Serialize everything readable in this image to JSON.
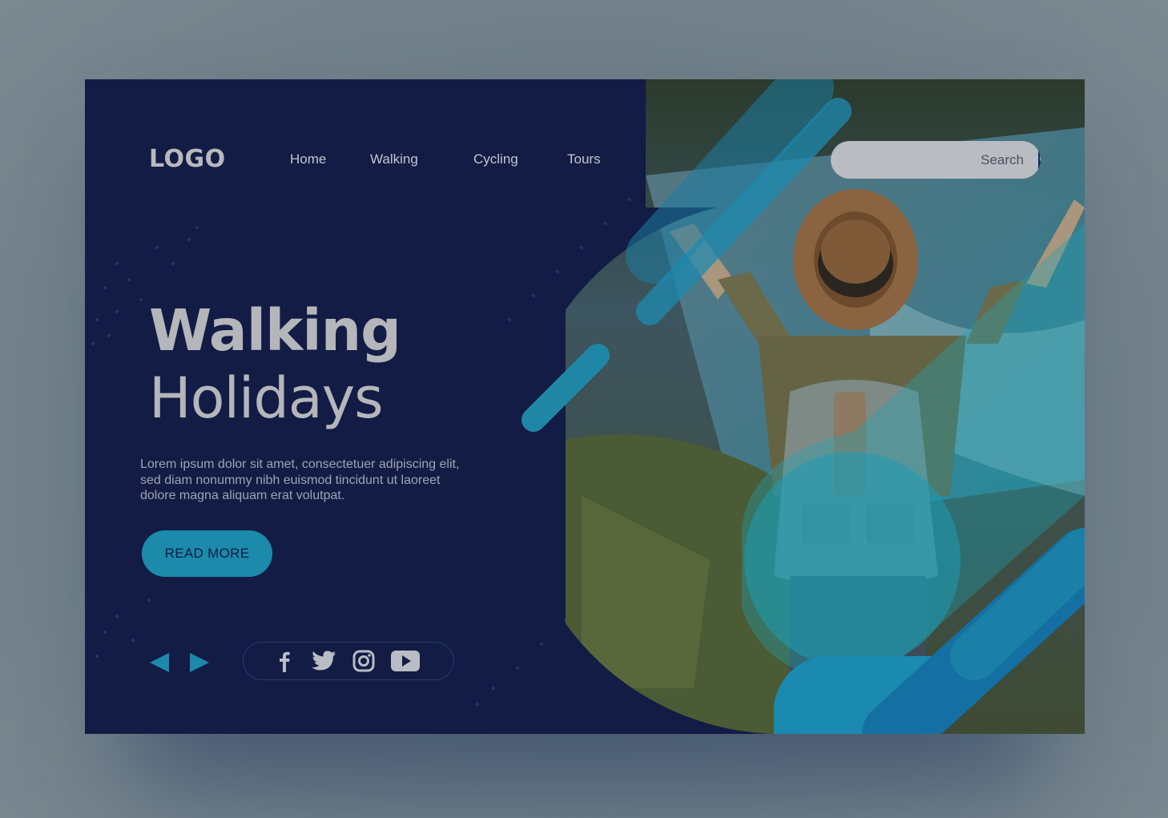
{
  "nav": {
    "logo": "LOGO",
    "items": [
      "Home",
      "Walking",
      "Cycling",
      "Tours"
    ]
  },
  "search": {
    "placeholder": "Search"
  },
  "hero": {
    "title": "Walking",
    "subtitle": "Holidays",
    "body": "Lorem ipsum dolor sit amet, consectetuer adipiscing elit, sed diam nonummy nibh euismod tincidunt ut laoreet dolore magna aliquam erat volutpat.",
    "cta_label": "READ MORE"
  },
  "icons": {
    "search": "search-icon",
    "prev": "arrow-left-icon",
    "next": "arrow-right-icon",
    "social": [
      "facebook-icon",
      "twitter-icon",
      "instagram-icon",
      "youtube-icon"
    ]
  },
  "colors": {
    "background": "#121c45",
    "accent": "#1c8aab",
    "text_light": "#b4b6ba",
    "search_button": "#0f2a66"
  }
}
